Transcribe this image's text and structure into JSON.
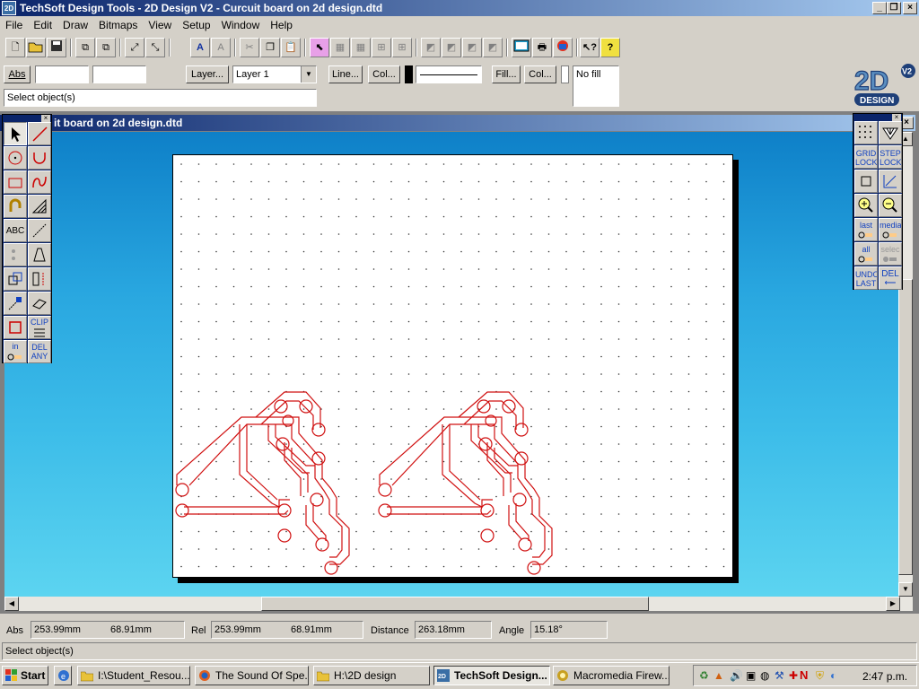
{
  "window": {
    "title": "TechSoft Design Tools - 2D Design V2 - Curcuit board on 2d design.dtd",
    "app_icon": "2D"
  },
  "menu": [
    "File",
    "Edit",
    "Draw",
    "Bitmaps",
    "View",
    "Setup",
    "Window",
    "Help"
  ],
  "toolbar2": {
    "abs_label": "Abs",
    "layer_button": "Layer...",
    "layer_value": "Layer 1",
    "line_button": "Line...",
    "col_button": "Col...",
    "fill_button": "Fill...",
    "col2_button": "Col...",
    "fill_value": "No fill",
    "prompt": "Select object(s)"
  },
  "logo": {
    "big": "2D",
    "version": "V2",
    "sub": "DESIGN"
  },
  "document": {
    "title": "Curcuit board on 2d design.dtd",
    "title_visible": "it board on 2d design.dtd"
  },
  "left_palette": {
    "abc": "ABC",
    "clip": "CLIP",
    "in": "in",
    "del_any_1": "DEL",
    "del_any_2": "ANY"
  },
  "right_palette": {
    "grid_lock_1": "GRID",
    "grid_lock_2": "LOCK",
    "step_lock_1": "STEP",
    "step_lock_2": "LOCK",
    "last": "last",
    "media": "media",
    "all": "all",
    "select": "selec",
    "undo_1": "UNDO",
    "undo_2": "LAST",
    "del": "DEL"
  },
  "status": {
    "abs_label": "Abs",
    "abs_x": "253.99mm",
    "abs_y": "68.91mm",
    "rel_label": "Rel",
    "rel_x": "253.99mm",
    "rel_y": "68.91mm",
    "distance_label": "Distance",
    "distance": "263.18mm",
    "angle_label": "Angle",
    "angle": "15.18°",
    "message": "Select object(s)"
  },
  "taskbar": {
    "start": "Start",
    "tasks": [
      {
        "label": "I:\\Student_Resou...",
        "icon": "folder-icon"
      },
      {
        "label": "The Sound Of Spe...",
        "icon": "firefox-icon"
      },
      {
        "label": "H:\\2D design",
        "icon": "folder-icon"
      },
      {
        "label": "TechSoft Design...",
        "icon": "techsoft-icon",
        "active": true
      },
      {
        "label": "Macromedia Firew...",
        "icon": "fireworks-icon"
      }
    ],
    "clock": "2:47 p.m."
  },
  "colors": {
    "title_active": "#0a246a",
    "canvas_top": "#0e80c8",
    "canvas_bottom": "#5cd4f0",
    "trace": "#d01010"
  }
}
